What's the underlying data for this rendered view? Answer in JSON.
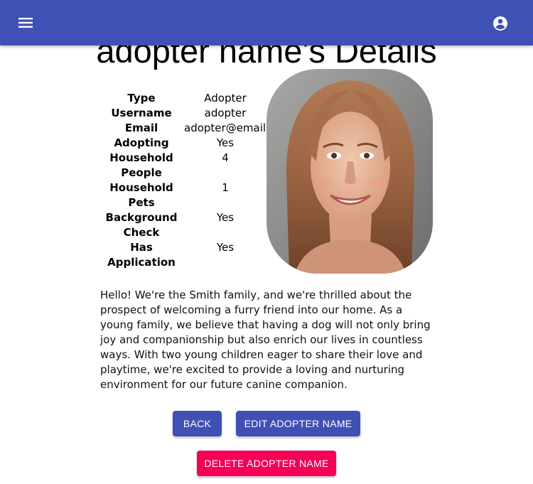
{
  "header": {
    "menu_icon": "menu-icon",
    "account_icon": "account-circle-icon",
    "bar_color": "#3f51b5"
  },
  "page": {
    "title": "adopter name's Details"
  },
  "details": {
    "rows": [
      {
        "label": "Type",
        "value": "Adopter"
      },
      {
        "label": "Username",
        "value": "adopter"
      },
      {
        "label": "Email",
        "value": "adopter@email.com"
      },
      {
        "label": "Adopting",
        "value": "Yes"
      },
      {
        "label": "Household People",
        "value": "4"
      },
      {
        "label": "Household Pets",
        "value": "1"
      },
      {
        "label": "Background Check",
        "value": "Yes"
      },
      {
        "label": "Has Application",
        "value": "Yes"
      }
    ]
  },
  "bio": "Hello! We're the Smith family, and we're thrilled about the prospect of welcoming a furry friend into our home. As a young family, we believe that having a dog will not only bring joy and companionship but also enrich our lives in countless ways. With two young children eager to share their love and playtime, we're excited to provide a loving and nurturing environment for our future canine companion.",
  "actions": {
    "back_label": "BACK",
    "edit_label": "EDIT ADOPTER NAME",
    "delete_label": "DELETE ADOPTER NAME",
    "primary_color": "#3f51b5",
    "danger_color": "#f50057"
  }
}
